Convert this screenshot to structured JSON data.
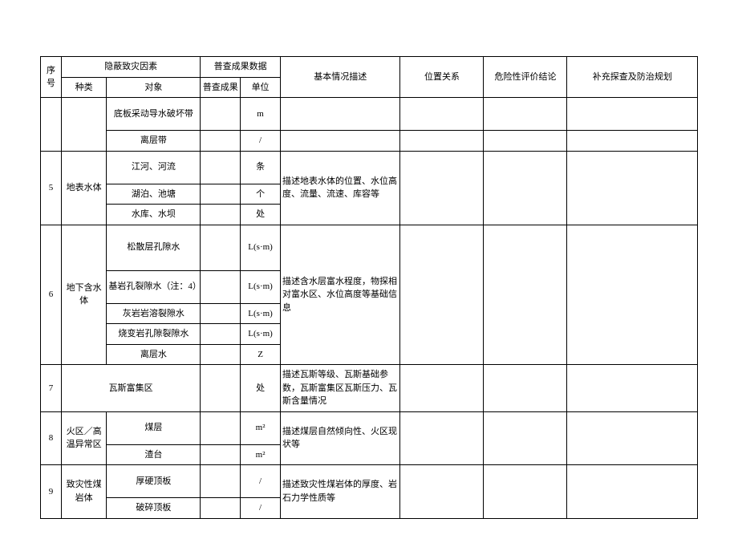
{
  "headers": {
    "seq": "序号",
    "hazard_factor": "隐蔽致灾因素",
    "kind": "种类",
    "object": "对象",
    "survey_data": "普查成果数据",
    "survey_result": "普查成果",
    "unit": "单位",
    "basic_desc": "基本情况描述",
    "position_rel": "位置关系",
    "risk_eval": "危险性评价结论",
    "supplement_plan": "补充探查及防治规划"
  },
  "rows": {
    "r_prev1": {
      "object": "底板采动导水破坏带",
      "unit": "m"
    },
    "r_prev2": {
      "object": "离层带",
      "unit": "/"
    },
    "r5": {
      "seq": "5",
      "kind": "地表水体",
      "a": {
        "object": "江河、河流",
        "unit": "条",
        "desc": "描述地表水体的位置、水位高度、流量、流速、库容等"
      },
      "b": {
        "object": "湖泊、池塘",
        "unit": "个"
      },
      "c": {
        "object": "水库、水坝",
        "unit": "处"
      }
    },
    "r6": {
      "seq": "6",
      "kind": "地下含水体",
      "a": {
        "object": "松散层孔隙水",
        "unit": "L(s·m)",
        "desc": "描述含水层富水程度，物探相对富水区、水位高度等基础信息"
      },
      "b": {
        "object": "基岩孔裂隙水（注：4）",
        "unit": "L(s·m)"
      },
      "c": {
        "object": "灰岩岩溶裂隙水",
        "unit": "L(s·m)"
      },
      "d": {
        "object": "烧变岩孔隙裂隙水",
        "unit": "L(s·m)"
      },
      "e": {
        "object": "离层水",
        "unit": "Z"
      }
    },
    "r7": {
      "seq": "7",
      "kind_object": "瓦斯富集区",
      "unit": "处",
      "desc": "描述瓦斯等级、瓦斯基础参数，瓦斯富集区瓦斯压力、瓦斯含量情况"
    },
    "r8": {
      "seq": "8",
      "kind": "火区／高温异常区",
      "a": {
        "object": "煤层",
        "unit": "m²",
        "desc": "描述煤层自然倾向性、火区现状等"
      },
      "b": {
        "object": "渣台",
        "unit": "m²"
      }
    },
    "r9": {
      "seq": "9",
      "kind": "致灾性煤岩体",
      "a": {
        "object": "厚硬顶板",
        "unit": "/",
        "desc": "描述致灾性煤岩体的厚度、岩石力学性质等"
      },
      "b": {
        "object": "破碎顶板",
        "unit": "/"
      }
    }
  }
}
